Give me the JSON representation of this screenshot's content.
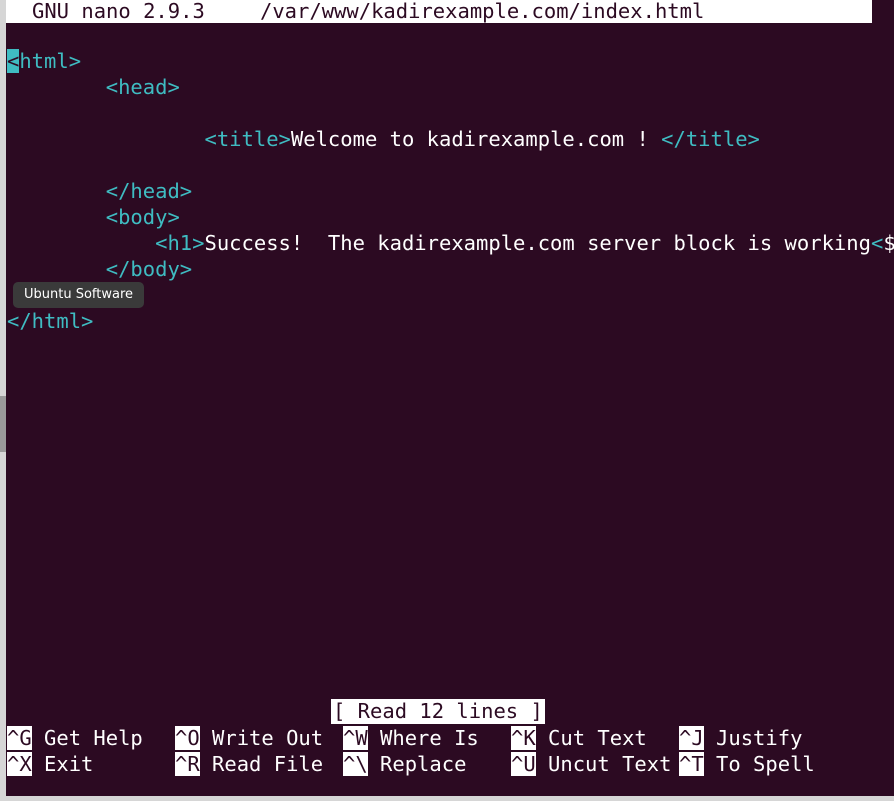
{
  "titlebar": {
    "app": "GNU nano 2.9.3",
    "file": "/var/www/kadirexample.com/index.html"
  },
  "editor": {
    "lines": [
      {
        "cursor": "<",
        "tag1": "html>",
        "indent": ""
      },
      {
        "indent": "        ",
        "tag1": "<head>"
      },
      {
        "indent": "                ",
        "tag1": "<title>",
        "text": "Welcome to kadirexample.com ! ",
        "tag2": "</title>"
      },
      {
        "indent": "        ",
        "tag1": "</head>"
      },
      {
        "indent": "        ",
        "tag1": "<body>"
      },
      {
        "indent": "            ",
        "tag1": "<h1>",
        "text": "Success!  The kadirexample.com server block is working",
        "tag2": "<",
        "text2": "$"
      },
      {
        "indent": "        ",
        "tag1": "</body>"
      },
      {
        "indent": "",
        "tag1": "</html>"
      }
    ]
  },
  "tooltip": {
    "label": "Ubuntu Software"
  },
  "status": {
    "message": "[ Read 12 lines ]"
  },
  "shortcuts": [
    {
      "key": "^G",
      "label": " Get Help"
    },
    {
      "key": "^O",
      "label": " Write Out"
    },
    {
      "key": "^W",
      "label": " Where Is"
    },
    {
      "key": "^K",
      "label": " Cut Text"
    },
    {
      "key": "^J",
      "label": " Justify"
    },
    {
      "key": "^X",
      "label": " Exit"
    },
    {
      "key": "^R",
      "label": " Read File"
    },
    {
      "key": "^\\",
      "label": " Replace"
    },
    {
      "key": "^U",
      "label": " Uncut Text"
    },
    {
      "key": "^T",
      "label": " To Spell"
    }
  ],
  "colors": {
    "background": "#2c0a22",
    "tag": "#3fbcc2",
    "text": "#ffffff"
  }
}
